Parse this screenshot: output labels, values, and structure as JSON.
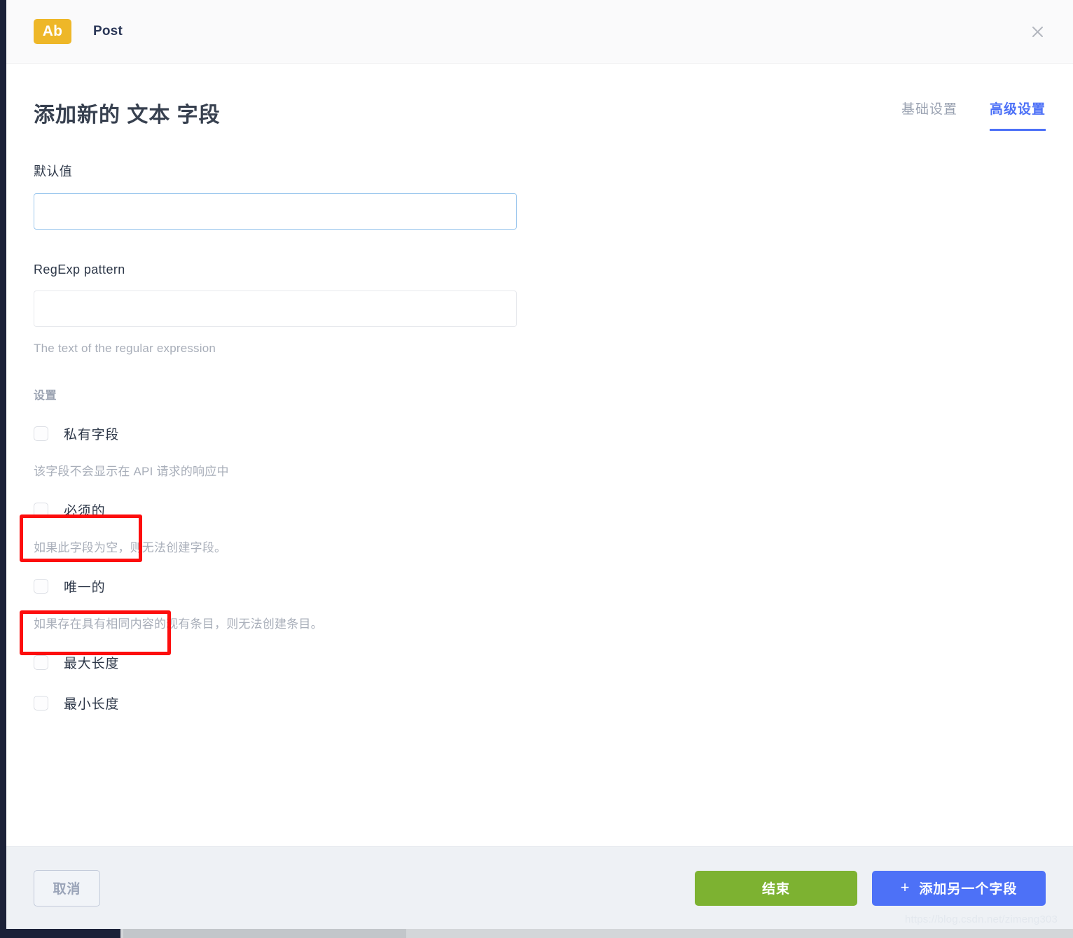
{
  "header": {
    "badge_text": "Ab",
    "title": "Post",
    "close_icon": "close-icon"
  },
  "content": {
    "page_title": "添加新的 文本 字段",
    "tabs": [
      {
        "label": "基础设置",
        "active": false
      },
      {
        "label": "高级设置",
        "active": true
      }
    ],
    "fields": {
      "default_value": {
        "label": "默认值",
        "value": "",
        "placeholder": ""
      },
      "regexp": {
        "label": "RegExp pattern",
        "value": "",
        "placeholder": "",
        "hint": "The text of the regular expression"
      }
    },
    "settings_label": "设置",
    "checkboxes": [
      {
        "label": "私有字段",
        "checked": false,
        "hint": "该字段不会显示在 API 请求的响应中",
        "highlighted": false
      },
      {
        "label": "必须的",
        "checked": false,
        "hint": "如果此字段为空，则无法创建字段。",
        "highlighted": true
      },
      {
        "label": "唯一的",
        "checked": false,
        "hint": "如果存在具有相同内容的现有条目，则无法创建条目。",
        "highlighted": true
      },
      {
        "label": "最大长度",
        "checked": false,
        "hint": "",
        "highlighted": false
      },
      {
        "label": "最小长度",
        "checked": false,
        "hint": "",
        "highlighted": false
      }
    ]
  },
  "footer": {
    "cancel_label": "取消",
    "finish_label": "结束",
    "add_field_label": "添加另一个字段",
    "add_field_plus": "+"
  },
  "watermark": "https://blog.csdn.net/zimeng303",
  "colors": {
    "accent_blue": "#4d71f7",
    "badge_yellow": "#eeb728",
    "finish_green": "#7db231",
    "annotation_red": "#fd0d0d",
    "footer_bg": "#eef1f5",
    "rail_dark": "#1b2138"
  }
}
